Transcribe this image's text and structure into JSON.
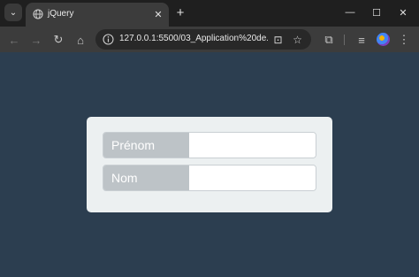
{
  "browser": {
    "tab_title": "jQuery",
    "tab_close": "✕",
    "new_tab": "+",
    "url": "127.0.0.1:5500/03_Application%20de..."
  },
  "form": {
    "fields": [
      {
        "label": "Prénom",
        "value": ""
      },
      {
        "label": "Nom",
        "value": ""
      }
    ]
  }
}
